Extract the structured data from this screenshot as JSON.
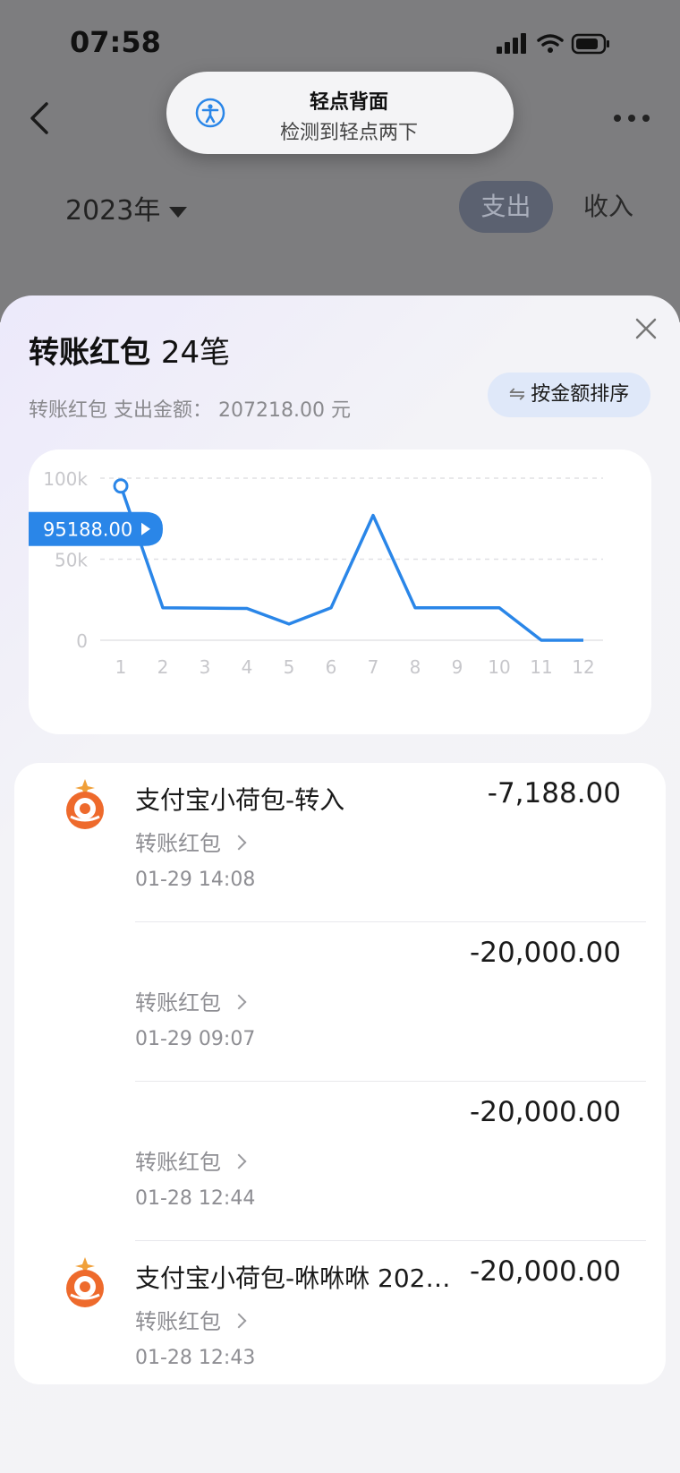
{
  "status_bar": {
    "time": "07:58"
  },
  "toast": {
    "title": "轻点背面",
    "message": "检测到轻点两下"
  },
  "header": {
    "year": "2023年",
    "tab_expense": "支出",
    "tab_income": "收入"
  },
  "sheet": {
    "title": "转账红包",
    "count": "24笔",
    "subtitle": "转账红包 支出金额：  207218.00 元",
    "sort_label": "按金额排序"
  },
  "chart_data": {
    "type": "line",
    "categories": [
      "1",
      "2",
      "3",
      "4",
      "5",
      "6",
      "7",
      "8",
      "9",
      "10",
      "11",
      "12"
    ],
    "values": [
      95188,
      20000,
      19800,
      19600,
      10000,
      20000,
      77000,
      20000,
      20000,
      20000,
      0,
      0
    ],
    "ytick_labels": [
      "100k",
      "50k",
      "0"
    ],
    "yticks": [
      100000,
      50000,
      0
    ],
    "ylim": [
      0,
      100000
    ],
    "tooltip_label": "95188.00",
    "highlight_index": 0,
    "line_color": "#2a86e8",
    "grid": "dashed-horizontal"
  },
  "transactions": [
    {
      "name": "支付宝小荷包-转入",
      "amount": "-7,188.00",
      "category": "转账红包",
      "time": "01-29 14:08",
      "icon": "alipay-hebao-icon"
    },
    {
      "name": "",
      "amount": "-20,000.00",
      "category": "转账红包",
      "time": "01-29 09:07",
      "icon": ""
    },
    {
      "name": "",
      "amount": "-20,000.00",
      "category": "转账红包",
      "time": "01-28 12:44",
      "icon": ""
    },
    {
      "name": "支付宝小荷包-咻咻咻 2023...",
      "amount": "-20,000.00",
      "category": "转账红包",
      "time": "01-28 12:43",
      "icon": "alipay-hebao-icon"
    }
  ]
}
